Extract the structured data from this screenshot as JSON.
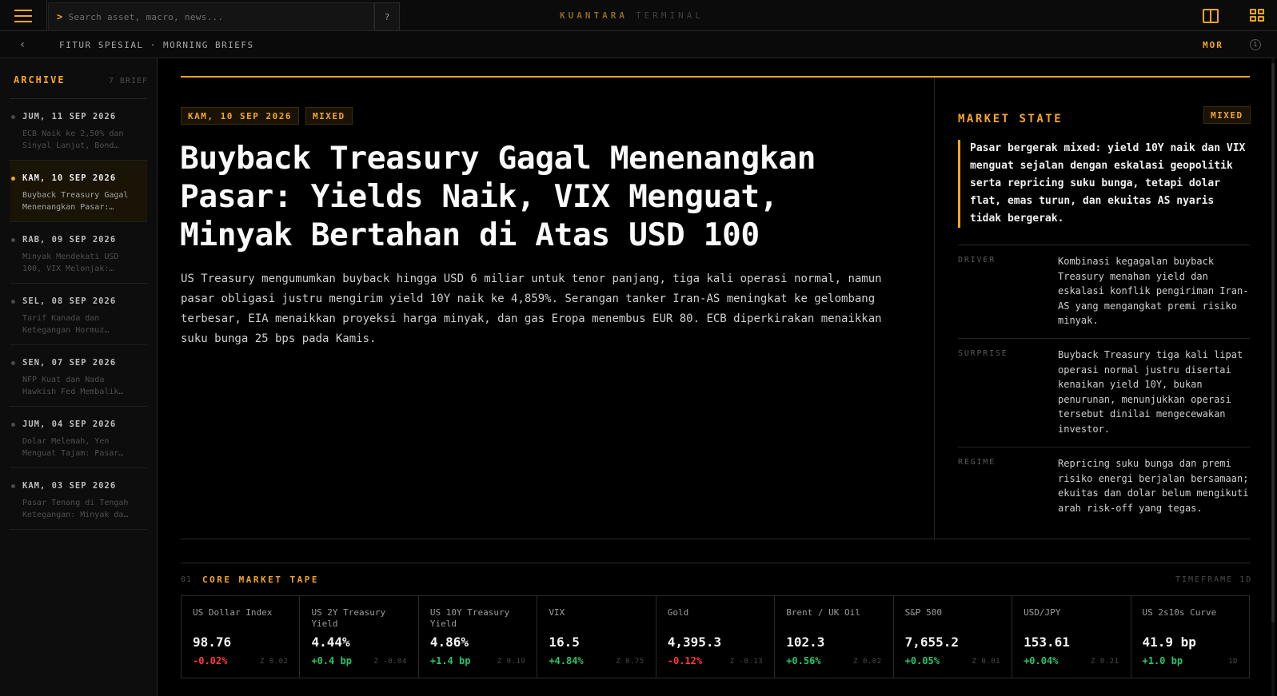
{
  "topbar": {
    "search_placeholder": "Search asset, macro, news...",
    "help_label": "?",
    "brand_primary": "KUANTARA",
    "brand_secondary": "TERMINAL"
  },
  "subbar": {
    "breadcrumb": "FITUR SPESIAL · MORNING BRIEFS",
    "session_label": "MOR",
    "info_label": "i"
  },
  "sidebar": {
    "title": "ARCHIVE",
    "count": "7 BRIEF",
    "items": [
      {
        "date": "JUM, 11 SEP 2026",
        "snippet": "ECB Naik ke 2,50% dan Sinyal Lanjut, Bond…",
        "active": false
      },
      {
        "date": "KAM, 10 SEP 2026",
        "snippet": "Buyback Treasury Gagal Menenangkan Pasar:…",
        "active": true
      },
      {
        "date": "RAB, 09 SEP 2026",
        "snippet": "Minyak Mendekati USD 100, VIX Melonjak:…",
        "active": false
      },
      {
        "date": "SEL, 08 SEP 2026",
        "snippet": "Tarif Kanada dan Ketegangan Hormuz…",
        "active": false
      },
      {
        "date": "SEN, 07 SEP 2026",
        "snippet": "NFP Kuat dan Nada Hawkish Fed Membalik…",
        "active": false
      },
      {
        "date": "JUM, 04 SEP 2026",
        "snippet": "Dolar Melemah, Yen Menguat Tajam: Pasar…",
        "active": false
      },
      {
        "date": "KAM, 03 SEP 2026",
        "snippet": "Pasar Tenang di Tengah Ketegangan: Minyak da…",
        "active": false
      }
    ]
  },
  "article": {
    "date_tag": "KAM, 10 SEP 2026",
    "sentiment_tag": "MIXED",
    "headline": "Buyback Treasury Gagal Menenangkan Pasar: Yields Naik, VIX Menguat, Minyak Bertahan di Atas USD 100",
    "lede": "US Treasury mengumumkan buyback hingga USD 6 miliar untuk tenor panjang, tiga kali operasi normal, namun pasar obligasi justru mengirim yield 10Y naik ke 4,859%. Serangan tanker Iran-AS meningkat ke gelombang terbesar, EIA menaikkan proyeksi harga minyak, dan gas Eropa menembus EUR 80. ECB diperkirakan menaikkan suku bunga 25 bps pada Kamis."
  },
  "market_state": {
    "title": "MARKET STATE",
    "badge": "MIXED",
    "summary": "Pasar bergerak mixed: yield 10Y naik dan VIX menguat sejalan dengan eskalasi geopolitik serta repricing suku bunga, tetapi dolar flat, emas turun, dan ekuitas AS nyaris tidak bergerak.",
    "rows": [
      {
        "key": "DRIVER",
        "value": "Kombinasi kegagalan buyback Treasury menahan yield dan eskalasi konflik pengiriman Iran-AS yang mengangkat premi risiko minyak."
      },
      {
        "key": "SURPRISE",
        "value": "Buyback Treasury tiga kali lipat operasi normal justru disertai kenaikan yield 10Y, bukan penurunan, menunjukkan operasi tersebut dinilai mengecewakan investor."
      },
      {
        "key": "REGIME",
        "value": "Repricing suku bunga dan premi risiko energi berjalan bersamaan; ekuitas dan dolar belum mengikuti arah risk-off yang tegas."
      }
    ]
  },
  "tape": {
    "section_num": "01",
    "title": "CORE MARKET TAPE",
    "meta": "TIMEFRAME 1D",
    "colors": {
      "up": "#27c46a",
      "down": "#ff3b3b",
      "accent": "#f5a623"
    },
    "tiles": [
      {
        "name": "US Dollar Index",
        "value": "98.76",
        "change": "-0.02%",
        "dir": "down",
        "z": "Z 0.02"
      },
      {
        "name": "US 2Y Treasury Yield",
        "value": "4.44%",
        "change": "+0.4 bp",
        "dir": "up",
        "z": "Z -0.04"
      },
      {
        "name": "US 10Y Treasury Yield",
        "value": "4.86%",
        "change": "+1.4 bp",
        "dir": "up",
        "z": "Z 0.19"
      },
      {
        "name": "VIX",
        "value": "16.5",
        "change": "+4.84%",
        "dir": "up",
        "z": "Z 0.75"
      },
      {
        "name": "Gold",
        "value": "4,395.3",
        "change": "-0.12%",
        "dir": "down",
        "z": "Z -0.13"
      },
      {
        "name": "Brent / UK Oil",
        "value": "102.3",
        "change": "+0.56%",
        "dir": "up",
        "z": "Z 0.02"
      },
      {
        "name": "S&P 500",
        "value": "7,655.2",
        "change": "+0.05%",
        "dir": "up",
        "z": "Z 0.01"
      },
      {
        "name": "USD/JPY",
        "value": "153.61",
        "change": "+0.04%",
        "dir": "up",
        "z": "Z 0.21"
      },
      {
        "name": "US 2s10s Curve",
        "value": "41.9 bp",
        "change": "+1.0 bp",
        "dir": "up",
        "z": "1D"
      }
    ]
  }
}
